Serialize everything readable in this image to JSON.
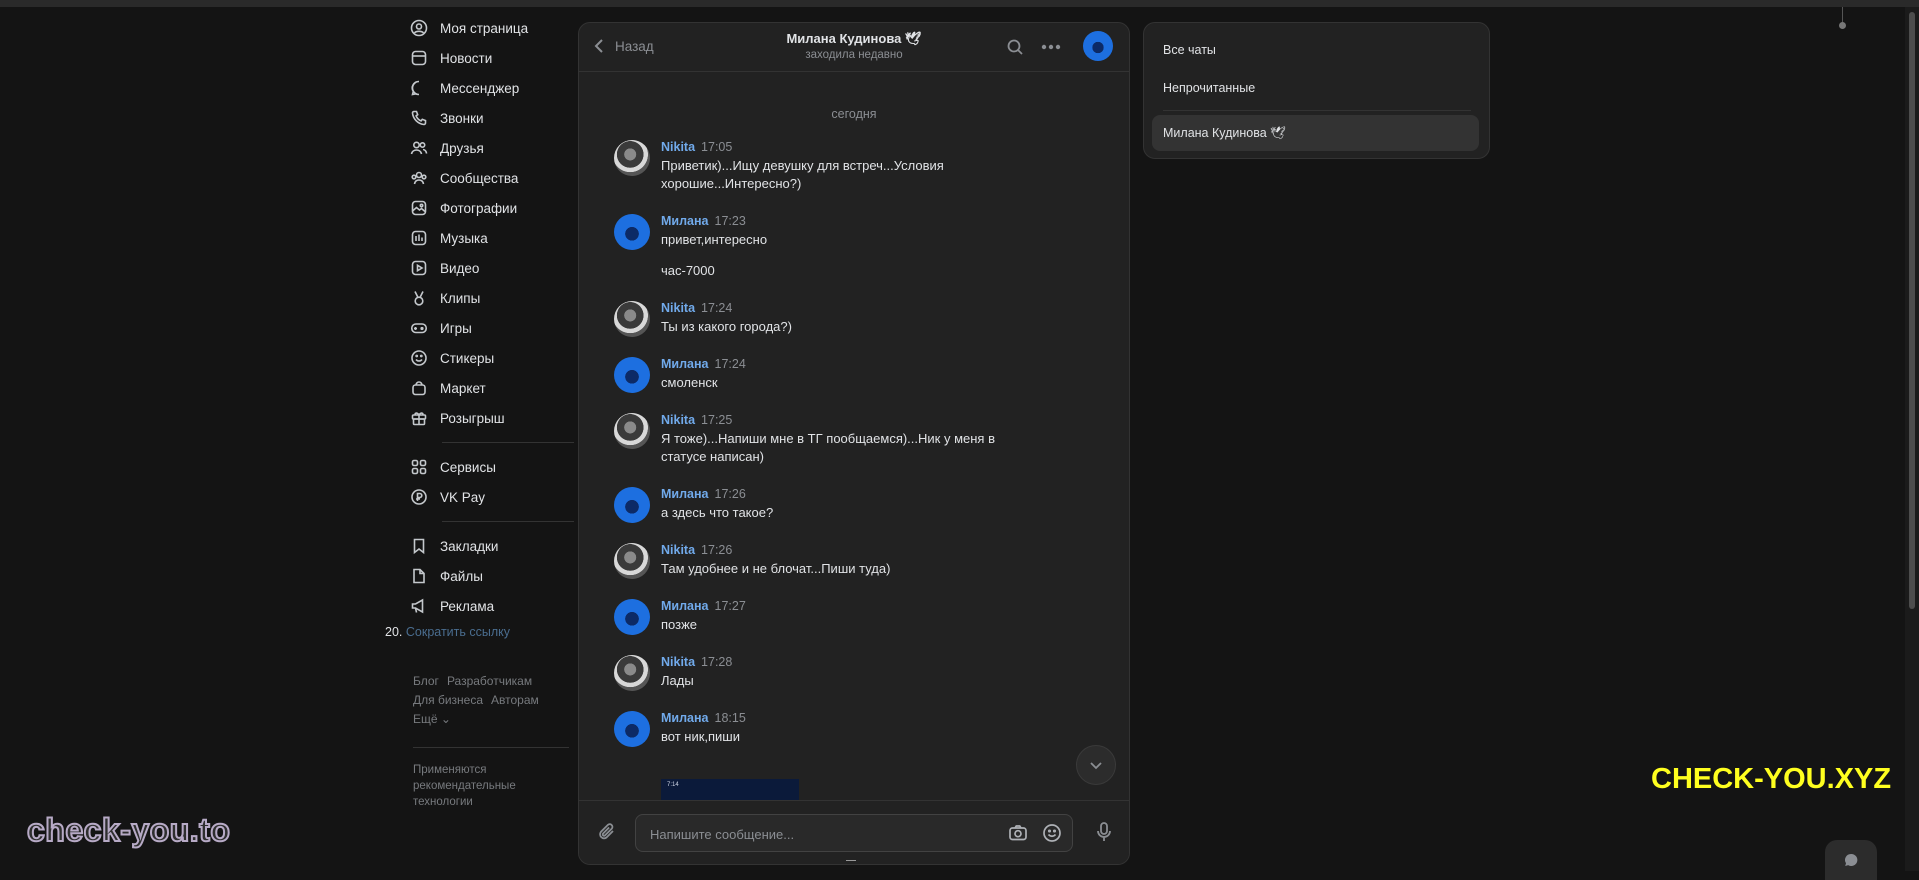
{
  "nav": {
    "items": [
      {
        "label": "Моя страница",
        "icon": "user-circle-icon"
      },
      {
        "label": "Новости",
        "icon": "news-icon"
      },
      {
        "label": "Мессенджер",
        "icon": "chat-bubble-icon"
      },
      {
        "label": "Звонки",
        "icon": "phone-icon"
      },
      {
        "label": "Друзья",
        "icon": "friends-icon"
      },
      {
        "label": "Сообщества",
        "icon": "communities-icon"
      },
      {
        "label": "Фотографии",
        "icon": "photo-icon"
      },
      {
        "label": "Музыка",
        "icon": "music-icon"
      },
      {
        "label": "Видео",
        "icon": "video-icon"
      },
      {
        "label": "Клипы",
        "icon": "clips-icon"
      },
      {
        "label": "Игры",
        "icon": "gamepad-icon"
      },
      {
        "label": "Стикеры",
        "icon": "sticker-icon"
      },
      {
        "label": "Маркет",
        "icon": "shopping-bag-icon"
      },
      {
        "label": "Розыгрыш",
        "icon": "gift-icon"
      }
    ],
    "services": [
      {
        "label": "Сервисы",
        "icon": "grid-icon"
      },
      {
        "label": "VK Pay",
        "icon": "vkpay-icon"
      }
    ],
    "extra": [
      {
        "label": "Закладки",
        "icon": "bookmark-icon"
      },
      {
        "label": "Файлы",
        "icon": "file-icon"
      },
      {
        "label": "Реклама",
        "icon": "megaphone-icon"
      }
    ],
    "shorten_num": "20.",
    "shorten_link": "Сократить ссылку"
  },
  "footer": {
    "links": [
      "Блог",
      "Разработчикам",
      "Для бизнеса",
      "Авторам",
      "Ещё ⌄"
    ],
    "recommendation": "Применяются рекомендательные технологии"
  },
  "chat": {
    "back_label": "Назад",
    "peer_name": "Милана Кудинова",
    "peer_badge": "🕊",
    "peer_status": "заходила недавно",
    "day_separator": "сегодня",
    "messages": [
      {
        "author": "Nikita",
        "time": "17:05",
        "text": "Приветик)...Ищу девушку для встреч...Условия хорошие...Интересно?)"
      },
      {
        "author": "Милана",
        "time": "17:23",
        "text": "привет,интересно"
      },
      {
        "author": "",
        "time": "",
        "text": "час-7000"
      },
      {
        "author": "Nikita",
        "time": "17:24",
        "text": "Ты из какого города?)"
      },
      {
        "author": "Милана",
        "time": "17:24",
        "text": "смоленск"
      },
      {
        "author": "Nikita",
        "time": "17:25",
        "text": "Я тоже)...Напиши мне в ТГ пообщаемся)...Ник у меня в статусе написан)"
      },
      {
        "author": "Милана",
        "time": "17:26",
        "text": "а здесь что такое?"
      },
      {
        "author": "Nikita",
        "time": "17:26",
        "text": "Там удобнее и не блочат...Пиши туда)"
      },
      {
        "author": "Милана",
        "time": "17:27",
        "text": "позже"
      },
      {
        "author": "Nikita",
        "time": "17:28",
        "text": "Лады"
      },
      {
        "author": "Милана",
        "time": "18:15",
        "text": "вот ник,пиши"
      }
    ],
    "photo_caption": "7:14",
    "composer_placeholder": "Напишите сообщение..."
  },
  "filters": {
    "all": "Все чаты",
    "unread": "Непрочитанные",
    "active": "Милана Кудинова 🕊"
  },
  "watermarks": {
    "left": "check-you.to",
    "right": "CHECK-YOU.XYZ"
  },
  "colors": {
    "accent": "#71aaeb",
    "background": "#141414",
    "panel": "#222222",
    "watermark_right": "#ffff1f"
  }
}
